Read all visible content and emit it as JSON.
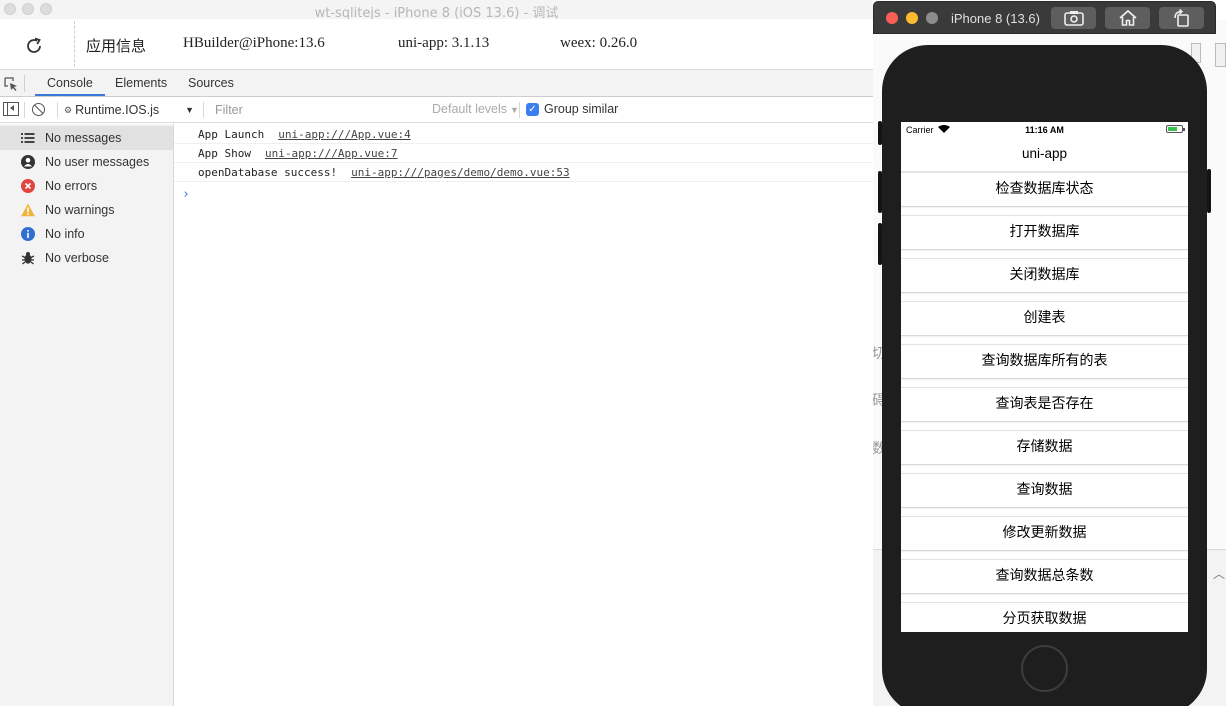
{
  "window": {
    "title": "wt-sqlitejs - iPhone 8 (iOS 13.6) - 调试"
  },
  "infobar": {
    "app_info": "应用信息",
    "hbuilder": "HBuilder@iPhone:13.6",
    "uniapp": "uni-app: 3.1.13",
    "weex": "weex: 0.26.0"
  },
  "tabs": [
    {
      "label": "Console"
    },
    {
      "label": "Elements"
    },
    {
      "label": "Sources"
    }
  ],
  "toolbar": {
    "context": "Runtime.IOS.js",
    "filter_placeholder": "Filter",
    "levels": "Default levels",
    "group_similar": "Group similar"
  },
  "sidebar": {
    "items": [
      {
        "label": "No messages",
        "icon": "list-icon"
      },
      {
        "label": "No user messages",
        "icon": "user-icon"
      },
      {
        "label": "No errors",
        "icon": "error-icon"
      },
      {
        "label": "No warnings",
        "icon": "warning-icon"
      },
      {
        "label": "No info",
        "icon": "info-icon"
      },
      {
        "label": "No verbose",
        "icon": "bug-icon"
      }
    ]
  },
  "console": {
    "logs": [
      {
        "text": "App Launch",
        "source": "uni-app:///App.vue:4"
      },
      {
        "text": "App Show",
        "source": "uni-app:///App.vue:7"
      },
      {
        "text": "openDatabase success!",
        "source": "uni-app:///pages/demo/demo.vue:53"
      }
    ],
    "prompt": "›"
  },
  "simulator": {
    "title": "iPhone 8 (13.6)",
    "statusbar": {
      "carrier": "Carrier",
      "time": "11:16 AM"
    },
    "nav_title": "uni-app",
    "buttons": [
      "检查数据库状态",
      "打开数据库",
      "关闭数据库",
      "创建表",
      "查询数据库所有的表",
      "查询表是否存在",
      "存储数据",
      "查询数据",
      "修改更新数据",
      "查询数据总条数",
      "分页获取数据"
    ],
    "bg_glyphs": [
      "切",
      "碍",
      "数"
    ]
  },
  "colors": {
    "accent": "#3879d9",
    "error": "#e0443e",
    "warning": "#f2b33d",
    "info": "#2f6fd0",
    "close": "#fc5f57",
    "minimize": "#fdbc2e",
    "zoom": "#8d8d8d"
  }
}
